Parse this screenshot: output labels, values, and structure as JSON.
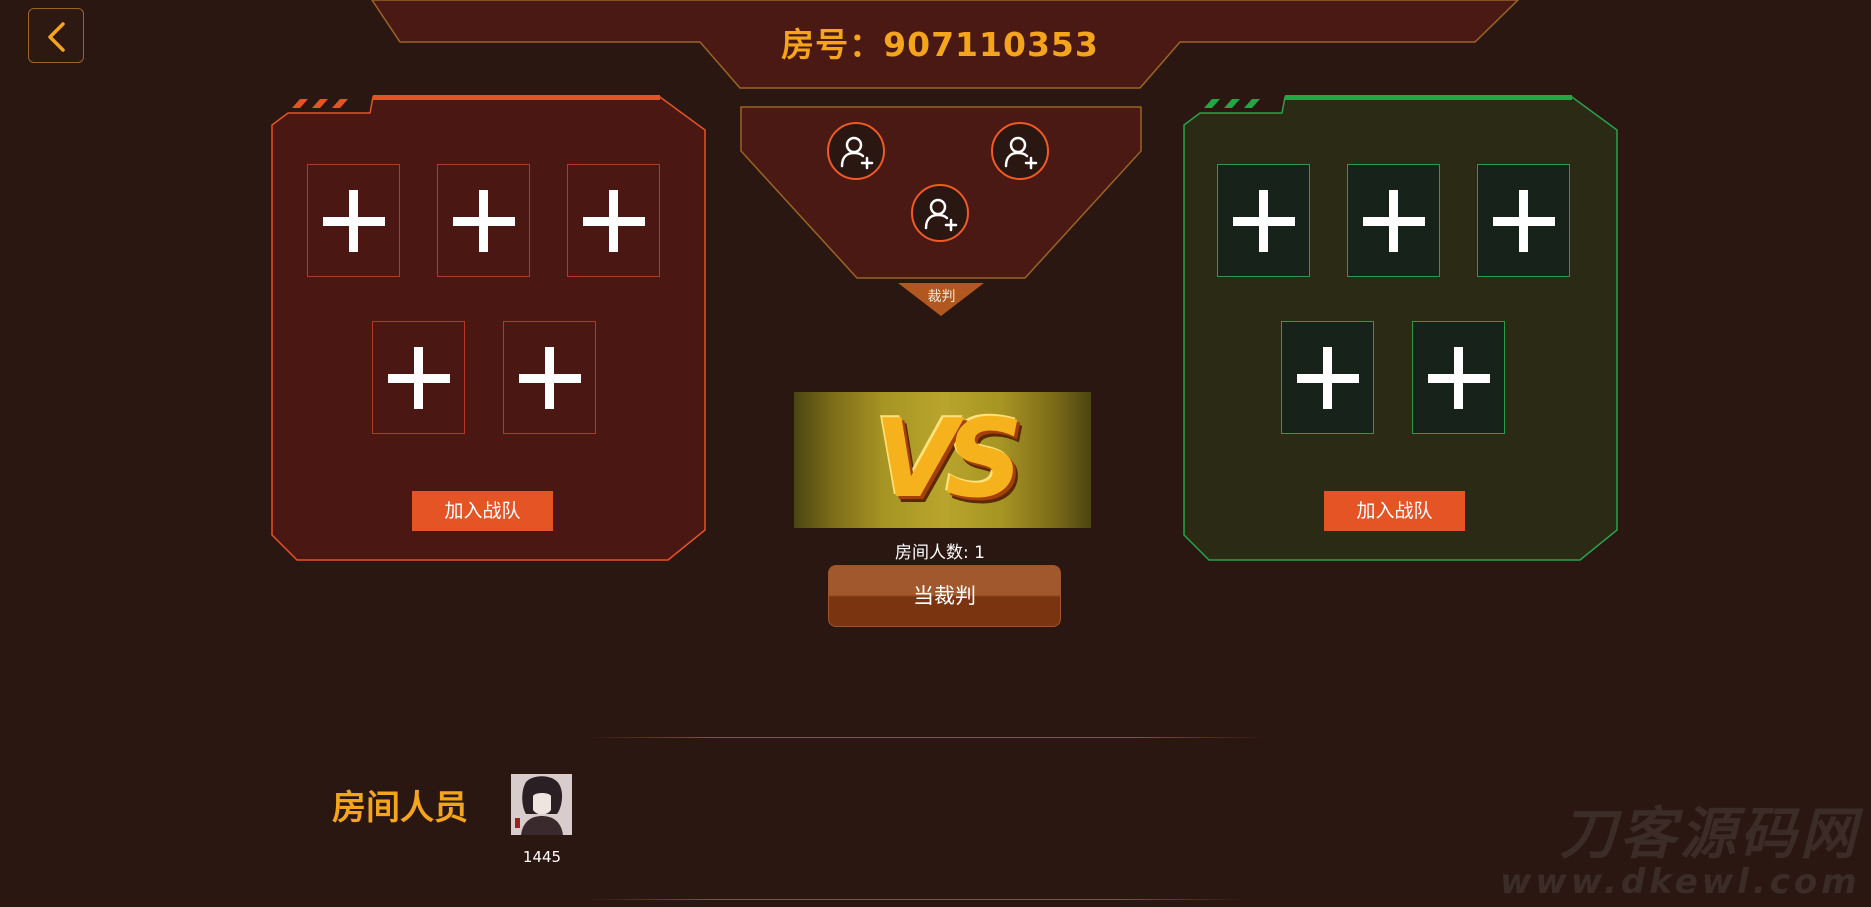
{
  "header": {
    "room_title": "房号：907110353"
  },
  "teams": {
    "red": {
      "accent": "#e45425",
      "join_label": "加入战队",
      "slot_count": 5
    },
    "green": {
      "accent": "#2a9a4b",
      "join_label": "加入战队",
      "slot_count": 5
    }
  },
  "referee": {
    "label": "裁判",
    "seats": 3
  },
  "vs": {
    "text": "VS"
  },
  "room_count_text": "房间人数: 1",
  "referee_button_label": "当裁判",
  "members": {
    "title": "房间人员",
    "list": [
      {
        "name": "1445"
      }
    ]
  },
  "watermark": {
    "text": "刀客源码网",
    "url": "www.dkewl.com"
  },
  "icons": {
    "back": "chevron-left-icon",
    "slot": "plus-icon",
    "seat": "add-user-icon"
  },
  "colors": {
    "background": "#2a1712",
    "title": "#f4a51c",
    "button": "#e45425"
  }
}
